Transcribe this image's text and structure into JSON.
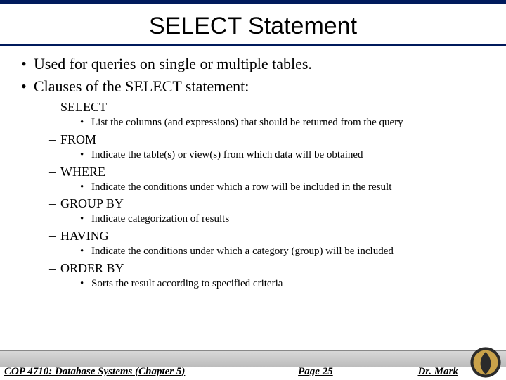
{
  "title": "SELECT Statement",
  "bullets": {
    "b1a": "Used for queries on single or multiple tables.",
    "b1b": "Clauses of the SELECT statement:",
    "select": {
      "name": "SELECT",
      "desc": "List the columns (and expressions) that should be returned from the query"
    },
    "from": {
      "name": "FROM",
      "desc": "Indicate the table(s) or view(s) from which data will be obtained"
    },
    "where": {
      "name": "WHERE",
      "desc": "Indicate the conditions under which a row will be included in the result"
    },
    "groupby": {
      "name": "GROUP BY",
      "desc": "Indicate categorization of results"
    },
    "having": {
      "name": "HAVING",
      "desc": "Indicate the conditions under which a category (group) will be included"
    },
    "orderby": {
      "name": "ORDER BY",
      "desc": "Sorts the result according to specified criteria"
    }
  },
  "footer": {
    "course": "COP 4710: Database Systems  (Chapter 5)",
    "page": "Page 25",
    "author": "Dr. Mark"
  }
}
